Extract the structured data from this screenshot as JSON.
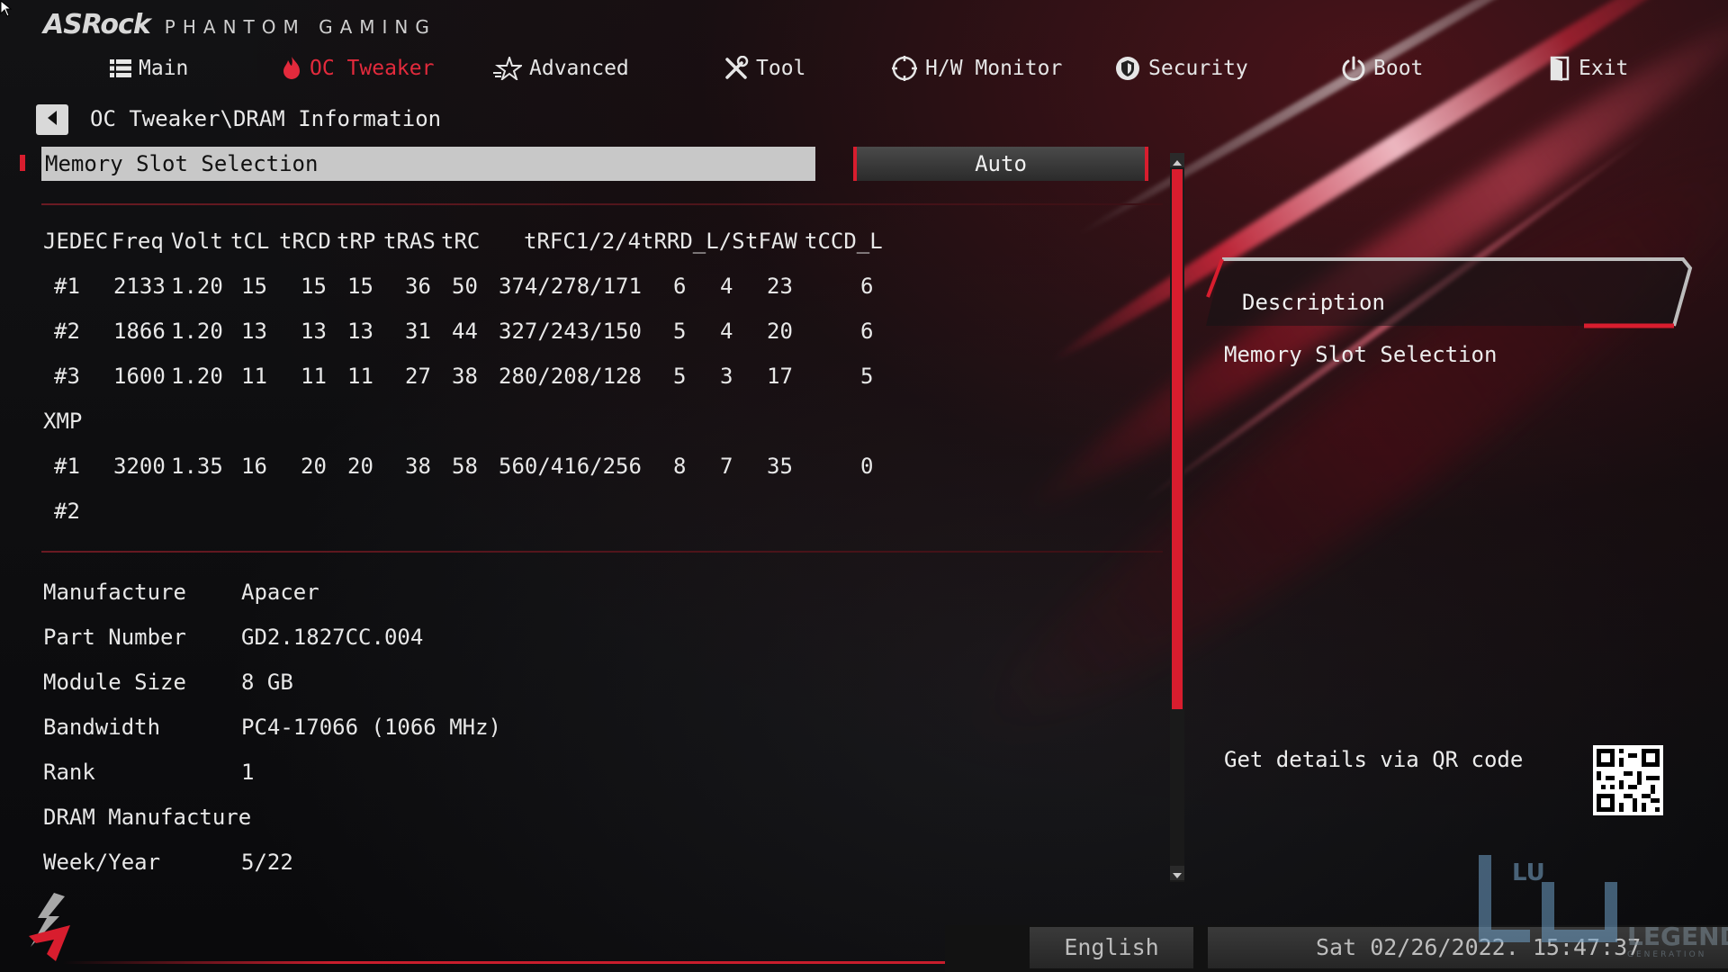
{
  "header": {
    "brand": "ASRock",
    "subtitle": "PHANTOM GAMING"
  },
  "nav": {
    "tabs": [
      {
        "label": "Main",
        "icon": "list-icon",
        "active": false
      },
      {
        "label": "OC Tweaker",
        "icon": "flame-icon",
        "active": true
      },
      {
        "label": "Advanced",
        "icon": "star-icon",
        "active": false
      },
      {
        "label": "Tool",
        "icon": "tools-icon",
        "active": false
      },
      {
        "label": "H/W Monitor",
        "icon": "monitor-gauge-icon",
        "active": false
      },
      {
        "label": "Security",
        "icon": "shield-icon",
        "active": false
      },
      {
        "label": "Boot",
        "icon": "power-icon",
        "active": false
      },
      {
        "label": "Exit",
        "icon": "exit-door-icon",
        "active": false
      }
    ],
    "active_color": "#e32a3c"
  },
  "breadcrumb": "OC Tweaker\\DRAM Information",
  "selection": {
    "label": "Memory Slot Selection",
    "value": "Auto"
  },
  "timing_table": {
    "header": [
      "JEDEC",
      "Freq",
      "Volt",
      "tCL",
      "tRCD",
      "tRP",
      "tRAS",
      "tRC",
      "tRFC1/2/4",
      "tRRD_L/S",
      "tFAW",
      "tCCD_L"
    ],
    "jedec_rows": [
      [
        "#1",
        "2133",
        "1.20",
        "15",
        "15",
        "15",
        "36",
        "50",
        "374/278/171",
        "6",
        "4",
        "23",
        "6"
      ],
      [
        "#2",
        "1866",
        "1.20",
        "13",
        "13",
        "13",
        "31",
        "44",
        "327/243/150",
        "5",
        "4",
        "20",
        "6"
      ],
      [
        "#3",
        "1600",
        "1.20",
        "11",
        "11",
        "11",
        "27",
        "38",
        "280/208/128",
        "5",
        "3",
        "17",
        "5"
      ]
    ],
    "xmp_label": "XMP",
    "xmp_rows": [
      [
        "#1",
        "3200",
        "1.35",
        "16",
        "20",
        "20",
        "38",
        "58",
        "560/416/256",
        "8",
        "7",
        "35",
        "0"
      ],
      [
        "#2",
        "",
        "",
        "",
        "",
        "",
        "",
        "",
        "",
        "",
        "",
        "",
        ""
      ]
    ]
  },
  "module_info": [
    {
      "key": "Manufacture",
      "value": "Apacer"
    },
    {
      "key": "Part Number",
      "value": "GD2.1827CC.004"
    },
    {
      "key": "Module Size",
      "value": "8 GB"
    },
    {
      "key": "Bandwidth",
      "value": "PC4-17066 (1066 MHz)"
    },
    {
      "key": "Rank",
      "value": "1"
    },
    {
      "key": "DRAM Manufacture",
      "value": ""
    },
    {
      "key": "Week/Year",
      "value": "5/22"
    }
  ],
  "description": {
    "title": "Description",
    "text": "Memory Slot Selection",
    "qr_prompt": "Get details via QR code"
  },
  "footer": {
    "language": "English",
    "datetime": "Sat 02/26/2022. 15:47:37"
  },
  "watermark": {
    "mark": "LU",
    "text": "LEGEND",
    "tagline": "GENERATION"
  },
  "colors": {
    "accent_red": "#d81d2e",
    "selected_bg": "#c8c8c8"
  }
}
